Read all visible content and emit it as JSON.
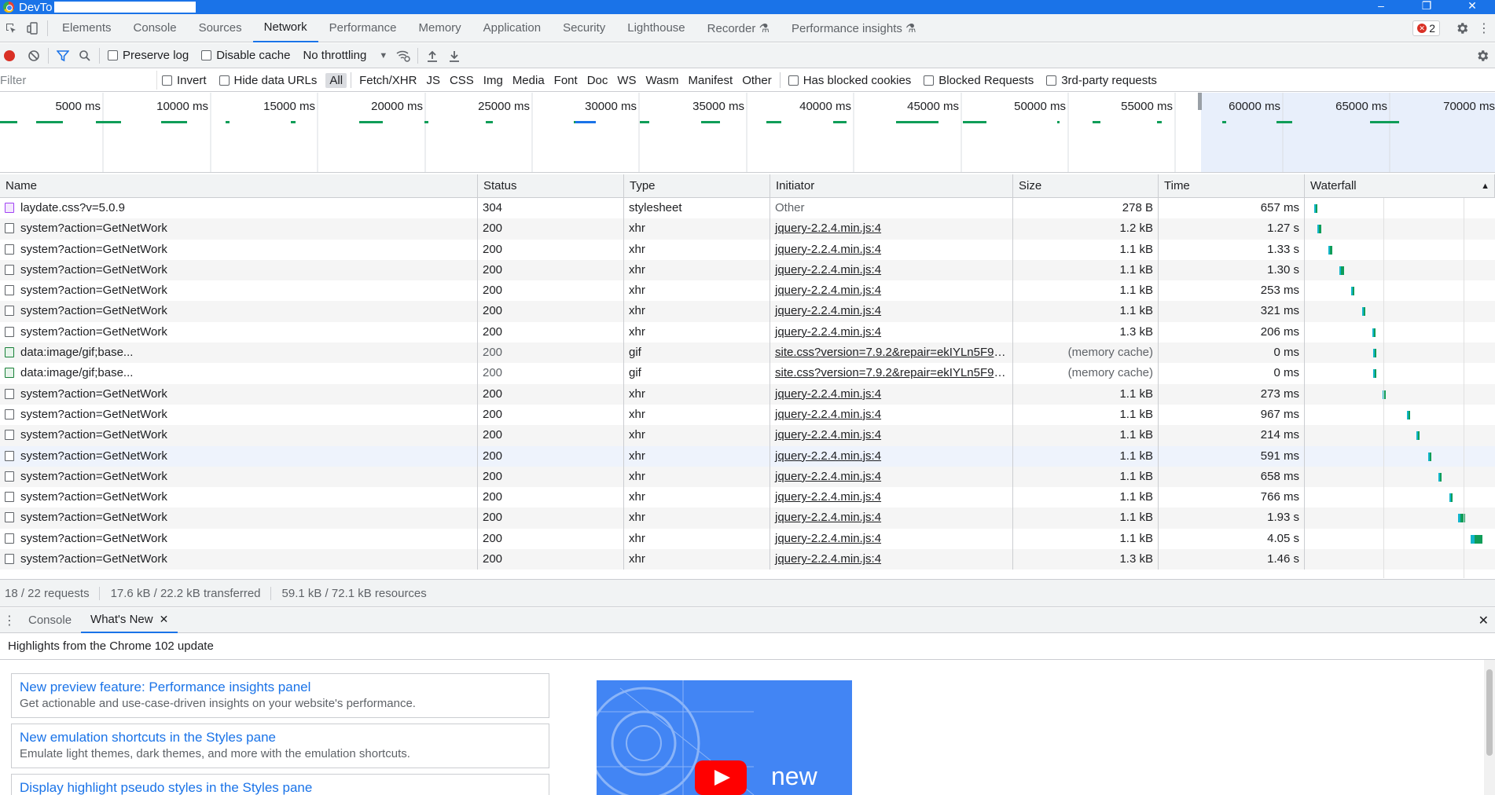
{
  "window": {
    "title": "DevTo",
    "controls": [
      "–",
      "❐",
      "✕"
    ]
  },
  "tabs": [
    {
      "label": "Elements",
      "active": false
    },
    {
      "label": "Console",
      "active": false
    },
    {
      "label": "Sources",
      "active": false
    },
    {
      "label": "Network",
      "active": true
    },
    {
      "label": "Performance",
      "active": false
    },
    {
      "label": "Memory",
      "active": false
    },
    {
      "label": "Application",
      "active": false
    },
    {
      "label": "Security",
      "active": false
    },
    {
      "label": "Lighthouse",
      "active": false
    },
    {
      "label": "Recorder ⚗",
      "active": false
    },
    {
      "label": "Performance insights ⚗",
      "active": false
    }
  ],
  "error_count": "2",
  "toolbar": {
    "preserve_log": "Preserve log",
    "disable_cache": "Disable cache",
    "throttling": "No throttling"
  },
  "filter": {
    "placeholder": "Filter",
    "invert": "Invert",
    "hide_data_urls": "Hide data URLs",
    "types": [
      "All",
      "Fetch/XHR",
      "JS",
      "CSS",
      "Img",
      "Media",
      "Font",
      "Doc",
      "WS",
      "Wasm",
      "Manifest",
      "Other"
    ],
    "active_type": "All",
    "has_blocked_cookies": "Has blocked cookies",
    "blocked_requests": "Blocked Requests",
    "third_party": "3rd-party requests"
  },
  "overview": {
    "ticks": [
      "5000 ms",
      "10000 ms",
      "15000 ms",
      "20000 ms",
      "25000 ms",
      "30000 ms",
      "35000 ms",
      "40000 ms",
      "45000 ms",
      "50000 ms",
      "55000 ms",
      "60000 ms",
      "65000 ms",
      "70000 ms"
    ]
  },
  "columns": [
    "Name",
    "Status",
    "Type",
    "Initiator",
    "Size",
    "Time",
    "Waterfall"
  ],
  "rows": [
    {
      "name": "laydate.css?v=5.0.9",
      "icon": "css",
      "status": "304",
      "type": "stylesheet",
      "initiator": "Other",
      "initiator_link": false,
      "size": "278 B",
      "time": "657 ms",
      "wf": [
        0.02,
        0.035
      ]
    },
    {
      "name": "system?action=GetNetWork",
      "icon": "doc",
      "status": "200",
      "type": "xhr",
      "initiator": "jquery-2.2.4.min.js:4",
      "initiator_link": true,
      "size": "1.2 kB",
      "time": "1.27 s",
      "wf": [
        0.045,
        0.07
      ]
    },
    {
      "name": "system?action=GetNetWork",
      "icon": "doc",
      "status": "200",
      "type": "xhr",
      "initiator": "jquery-2.2.4.min.js:4",
      "initiator_link": true,
      "size": "1.1 kB",
      "time": "1.33 s",
      "wf": [
        0.12,
        0.15
      ]
    },
    {
      "name": "system?action=GetNetWork",
      "icon": "doc",
      "status": "200",
      "type": "xhr",
      "initiator": "jquery-2.2.4.min.js:4",
      "initiator_link": true,
      "size": "1.1 kB",
      "time": "1.30 s",
      "wf": [
        0.2,
        0.23
      ]
    },
    {
      "name": "system?action=GetNetWork",
      "icon": "doc",
      "status": "200",
      "type": "xhr",
      "initiator": "jquery-2.2.4.min.js:4",
      "initiator_link": true,
      "size": "1.1 kB",
      "time": "253 ms",
      "wf": [
        0.28,
        0.29
      ]
    },
    {
      "name": "system?action=GetNetWork",
      "icon": "doc",
      "status": "200",
      "type": "xhr",
      "initiator": "jquery-2.2.4.min.js:4",
      "initiator_link": true,
      "size": "1.1 kB",
      "time": "321 ms",
      "wf": [
        0.36,
        0.37
      ]
    },
    {
      "name": "system?action=GetNetWork",
      "icon": "doc",
      "status": "200",
      "type": "xhr",
      "initiator": "jquery-2.2.4.min.js:4",
      "initiator_link": true,
      "size": "1.3 kB",
      "time": "206 ms",
      "wf": [
        0.43,
        0.44
      ]
    },
    {
      "name": "data:image/gif;base...",
      "icon": "img",
      "status": "200",
      "type": "gif",
      "initiator": "site.css?version=7.9.2&repair=ekIYLn5F9xd...",
      "initiator_link": true,
      "size": "(memory cache)",
      "time": "0 ms",
      "wf": [
        0.435,
        0.44
      ],
      "muted": true
    },
    {
      "name": "data:image/gif;base...",
      "icon": "img",
      "status": "200",
      "type": "gif",
      "initiator": "site.css?version=7.9.2&repair=ekIYLn5F9xd...",
      "initiator_link": true,
      "size": "(memory cache)",
      "time": "0 ms",
      "wf": [
        0.435,
        0.44
      ],
      "muted": true
    },
    {
      "name": "system?action=GetNetWork",
      "icon": "doc",
      "status": "200",
      "type": "xhr",
      "initiator": "jquery-2.2.4.min.js:4",
      "initiator_link": true,
      "size": "1.1 kB",
      "time": "273 ms",
      "wf": [
        0.5,
        0.51
      ]
    },
    {
      "name": "system?action=GetNetWork",
      "icon": "doc",
      "status": "200",
      "type": "xhr",
      "initiator": "jquery-2.2.4.min.js:4",
      "initiator_link": true,
      "size": "1.1 kB",
      "time": "967 ms",
      "wf": [
        0.67,
        0.69
      ]
    },
    {
      "name": "system?action=GetNetWork",
      "icon": "doc",
      "status": "200",
      "type": "xhr",
      "initiator": "jquery-2.2.4.min.js:4",
      "initiator_link": true,
      "size": "1.1 kB",
      "time": "214 ms",
      "wf": [
        0.74,
        0.75
      ]
    },
    {
      "name": "system?action=GetNetWork",
      "icon": "doc",
      "status": "200",
      "type": "xhr",
      "initiator": "jquery-2.2.4.min.js:4",
      "initiator_link": true,
      "size": "1.1 kB",
      "time": "591 ms",
      "wf": [
        0.82,
        0.83
      ],
      "highlight": true
    },
    {
      "name": "system?action=GetNetWork",
      "icon": "doc",
      "status": "200",
      "type": "xhr",
      "initiator": "jquery-2.2.4.min.js:4",
      "initiator_link": true,
      "size": "1.1 kB",
      "time": "658 ms",
      "wf": [
        0.89,
        0.9
      ]
    },
    {
      "name": "system?action=GetNetWork",
      "icon": "doc",
      "status": "200",
      "type": "xhr",
      "initiator": "jquery-2.2.4.min.js:4",
      "initiator_link": true,
      "size": "1.1 kB",
      "time": "766 ms",
      "wf": [
        0.97,
        0.98
      ]
    },
    {
      "name": "system?action=GetNetWork",
      "icon": "doc",
      "status": "200",
      "type": "xhr",
      "initiator": "jquery-2.2.4.min.js:4",
      "initiator_link": true,
      "size": "1.1 kB",
      "time": "1.93 s",
      "wf": [
        1.03,
        1.08
      ]
    },
    {
      "name": "system?action=GetNetWork",
      "icon": "doc",
      "status": "200",
      "type": "xhr",
      "initiator": "jquery-2.2.4.min.js:4",
      "initiator_link": true,
      "size": "1.1 kB",
      "time": "4.05 s",
      "wf": [
        1.12,
        1.2
      ]
    },
    {
      "name": "system?action=GetNetWork",
      "icon": "doc",
      "status": "200",
      "type": "xhr",
      "initiator": "jquery-2.2.4.min.js:4",
      "initiator_link": true,
      "size": "1.3 kB",
      "time": "1.46 s",
      "wf": [
        1.3,
        1.34
      ]
    }
  ],
  "summary": {
    "requests": "18 / 22 requests",
    "transferred": "17.6 kB / 22.2 kB transferred",
    "resources": "59.1 kB / 72.1 kB resources"
  },
  "drawer": {
    "tabs": [
      "Console",
      "What's New"
    ],
    "active": "What's New",
    "heading": "Highlights from the Chrome 102 update",
    "cards": [
      {
        "title": "New preview feature: Performance insights panel",
        "desc": "Get actionable and use-case-driven insights on your website's performance."
      },
      {
        "title": "New emulation shortcuts in the Styles pane",
        "desc": "Emulate light themes, dark themes, and more with the emulation shortcuts."
      },
      {
        "title": "Display highlight pseudo styles in the Styles pane",
        "desc": ""
      }
    ],
    "video_caption": "new"
  },
  "colors": {
    "accent": "#1a73e8",
    "record": "#d93025",
    "wait": "#12b5cb",
    "receive": "#0f9d58"
  }
}
